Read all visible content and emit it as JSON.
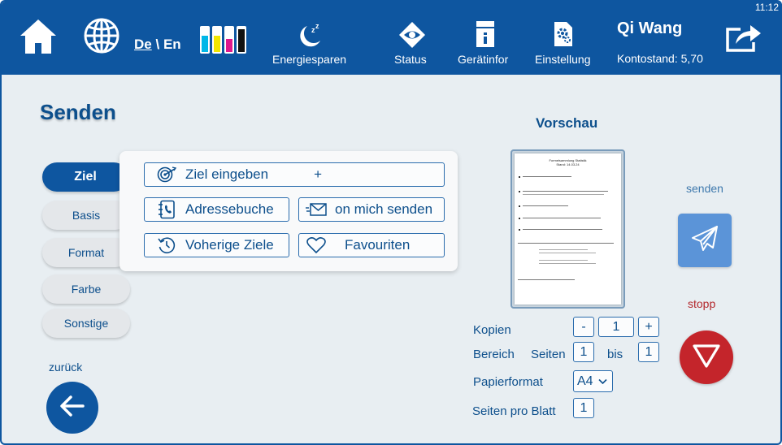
{
  "status_bar": {
    "time": "11:12"
  },
  "header": {
    "home_icon": "home-icon",
    "globe_icon": "globe-icon",
    "language": {
      "de": "De",
      "separator": "\\",
      "en": "En"
    },
    "ink_icon": "ink-cartridges-icon",
    "ink_colors": [
      "#00b7e8",
      "#f2e600",
      "#e0188c",
      "#111111"
    ],
    "items": [
      {
        "label": "Energiesparen",
        "icon": "moon-sleep-icon"
      },
      {
        "label": "Status",
        "icon": "eye-icon"
      },
      {
        "label": "Gerätinfor",
        "icon": "device-info-icon"
      },
      {
        "label": "Einstellung",
        "icon": "settings-icon"
      }
    ],
    "user": {
      "name": "Qi Wang",
      "balance": "Kontostand:  5,70"
    },
    "logout_icon": "share-exit-icon"
  },
  "page": {
    "title": "Senden"
  },
  "side_tabs": [
    {
      "label": "Ziel",
      "active": true
    },
    {
      "label": "Basis",
      "active": false
    },
    {
      "label": "Format",
      "active": false
    },
    {
      "label": "Farbe",
      "active": false
    },
    {
      "label": "Sonstige",
      "active": false
    }
  ],
  "destination": {
    "enter_label": "Ziel eingeben",
    "enter_plus": "+",
    "address_book_label": "Adressebuche",
    "send_to_me_label": "on mich senden",
    "previous_label": "Voherige Ziele",
    "favourites_label": "Favouriten"
  },
  "back": {
    "label": "zurück"
  },
  "preview": {
    "title": "Vorschau",
    "doc_title": "Formelsammlung Statistik",
    "doc_date": "Stand: 14.03.24"
  },
  "controls": {
    "copies_label": "Kopien",
    "minus": "-",
    "copies_value": "1",
    "plus": "+",
    "range_label": "Bereich",
    "pages_label": "Seiten",
    "range_from": "1",
    "bis_label": "bis",
    "range_to": "1",
    "paper_label": "Papierformat",
    "paper_value": "A4",
    "per_sheet_label": "Seiten pro Blatt",
    "per_sheet_value": "1"
  },
  "actions": {
    "send_label": "senden",
    "stop_label": "stopp"
  },
  "colors": {
    "primary": "#0e56a0",
    "send": "#5b94d8",
    "stop": "#c4252b",
    "background": "#e8eef2"
  }
}
